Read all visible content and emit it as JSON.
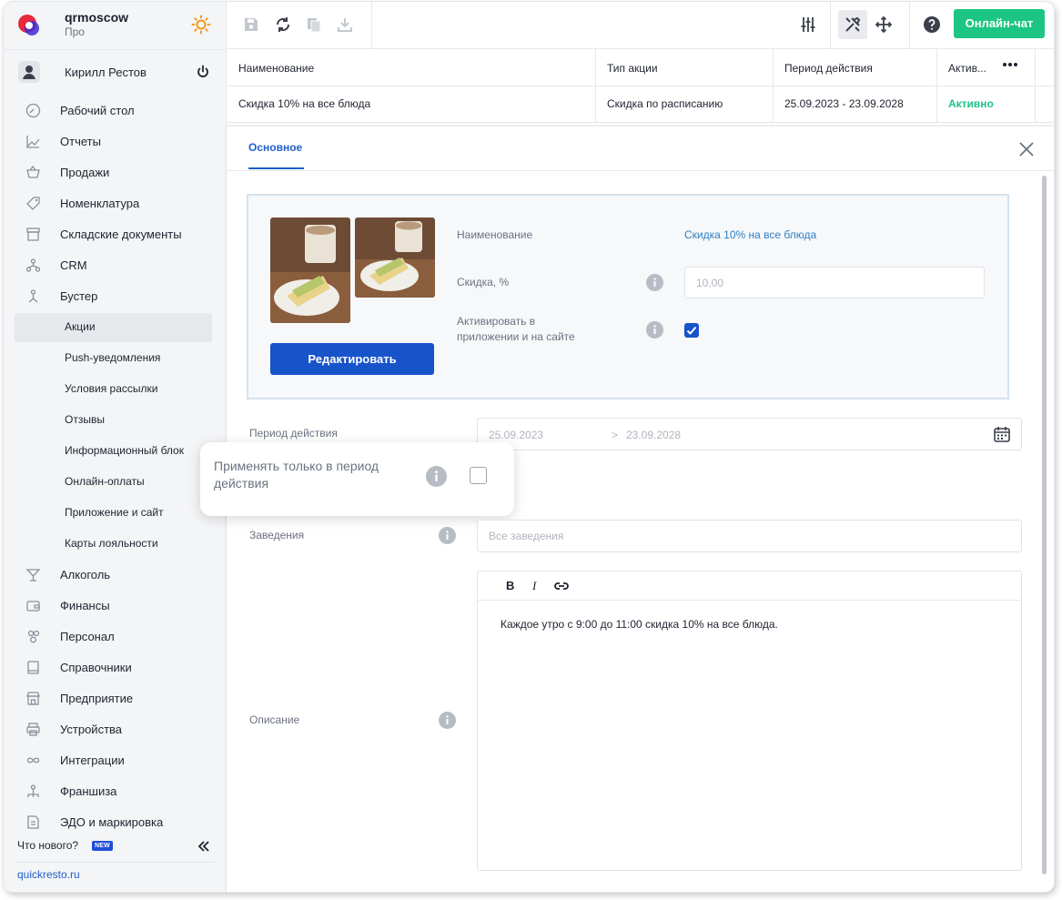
{
  "sidebar": {
    "org_name": "qrmoscow",
    "org_plan": "Про",
    "user_name": "Кирилл Рестов",
    "nav": [
      {
        "label": "Рабочий стол",
        "icon": "dashboard-icon"
      },
      {
        "label": "Отчеты",
        "icon": "reports-icon"
      },
      {
        "label": "Продажи",
        "icon": "sales-basket-icon"
      },
      {
        "label": "Номенклатура",
        "icon": "tag-icon"
      },
      {
        "label": "Складские документы",
        "icon": "warehouse-icon"
      },
      {
        "label": "CRM",
        "icon": "crm-icon"
      },
      {
        "label": "Бустер",
        "icon": "booster-icon"
      }
    ],
    "sub": [
      {
        "label": "Акции"
      },
      {
        "label": "Push-уведомления"
      },
      {
        "label": "Условия рассылки"
      },
      {
        "label": "Отзывы"
      },
      {
        "label": "Информационный блок"
      },
      {
        "label": "Онлайн-оплаты"
      },
      {
        "label": "Приложение и сайт"
      },
      {
        "label": "Карты лояльности"
      }
    ],
    "nav2": [
      {
        "label": "Алкоголь",
        "icon": "cocktail-icon"
      },
      {
        "label": "Финансы",
        "icon": "wallet-icon"
      },
      {
        "label": "Персонал",
        "icon": "staff-icon"
      },
      {
        "label": "Справочники",
        "icon": "book-icon"
      },
      {
        "label": "Предприятие",
        "icon": "store-icon"
      },
      {
        "label": "Устройства",
        "icon": "printer-icon"
      },
      {
        "label": "Интеграции",
        "icon": "infinity-icon"
      },
      {
        "label": "Франшиза",
        "icon": "franchise-icon"
      },
      {
        "label": "ЭДО и маркировка",
        "icon": "document-icon"
      }
    ],
    "whats_new": "Что нового?",
    "new_badge": "NEW",
    "site_link": "quickresto.ru"
  },
  "toolbar": {
    "chat_button": "Онлайн-чат"
  },
  "table": {
    "headers": [
      "Наименование",
      "Тип акции",
      "Период действия",
      "Актив..."
    ],
    "row": [
      "Скидка 10% на все блюда",
      "Скидка по расписанию",
      "25.09.2023 - 23.09.2028",
      "Активно"
    ]
  },
  "panel": {
    "tab": "Основное",
    "edit_button": "Редактировать",
    "name_label": "Наименование",
    "name_value": "Скидка 10% на все блюда",
    "discount_label": "Скидка, %",
    "discount_value": "10,00",
    "activate_label": "Активировать в приложении и на сайте",
    "activate_checked": true,
    "period_label": "Период действия",
    "period_from": "25.09.2023",
    "period_separator": ">",
    "period_to": "23.09.2028",
    "period_only_label": "Применять только в период действия",
    "period_only_checked": false,
    "venues_label": "Заведения",
    "venues_placeholder": "Все заведения",
    "description_label": "Описание",
    "description_text": "Каждое утро с 9:00 до 11:00 скидка 10% на все блюда.",
    "editor_buttons": {
      "bold": "B",
      "italic": "I"
    }
  },
  "colors": {
    "accent_blue": "#1753c9",
    "link_blue": "#1f5fc9",
    "success_green": "#1dc584"
  }
}
